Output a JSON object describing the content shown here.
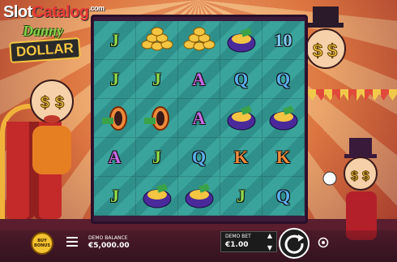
{
  "watermark": {
    "part1": "Slot",
    "part2": "Catalog",
    "dotcom": ".com"
  },
  "logo": {
    "top": "Danny",
    "bottom": "DOLLAR"
  },
  "colors": {
    "reel_bg_a": "#2f8f8a",
    "reel_bg_b": "#3aa39b",
    "frame": "#3c1a3a"
  },
  "grid": [
    [
      {
        "label": "J",
        "color": "#8fdc4a",
        "icon": "j-symbol"
      },
      {
        "label": "",
        "icon": "coin-stack-symbol"
      },
      {
        "label": "",
        "icon": "coin-stack-symbol"
      },
      {
        "label": "",
        "icon": "hat-of-gold-symbol"
      },
      {
        "label": "10",
        "color": "#7ec8f0",
        "icon": "ten-symbol"
      }
    ],
    [
      {
        "label": "J",
        "color": "#8fdc4a",
        "icon": "j-symbol"
      },
      {
        "label": "J",
        "color": "#8fdc4a",
        "icon": "j-symbol"
      },
      {
        "label": "A",
        "color": "#c86ae8",
        "icon": "a-symbol"
      },
      {
        "label": "Q",
        "color": "#5ab0f0",
        "icon": "q-symbol"
      },
      {
        "label": "Q",
        "color": "#5ab0f0",
        "icon": "q-symbol"
      }
    ],
    [
      {
        "label": "",
        "icon": "cannon-symbol"
      },
      {
        "label": "",
        "icon": "cannon-symbol"
      },
      {
        "label": "A",
        "color": "#c86ae8",
        "icon": "a-symbol"
      },
      {
        "label": "",
        "icon": "hat-of-gold-symbol"
      },
      {
        "label": "",
        "icon": "hat-of-gold-symbol"
      }
    ],
    [
      {
        "label": "A",
        "color": "#c86ae8",
        "icon": "a-symbol"
      },
      {
        "label": "J",
        "color": "#8fdc4a",
        "icon": "j-symbol"
      },
      {
        "label": "Q",
        "color": "#5ab0f0",
        "icon": "q-symbol"
      },
      {
        "label": "K",
        "color": "#f08a3a",
        "icon": "k-symbol"
      },
      {
        "label": "K",
        "color": "#f08a3a",
        "icon": "k-symbol"
      }
    ],
    [
      {
        "label": "J",
        "color": "#8fdc4a",
        "icon": "j-symbol"
      },
      {
        "label": "",
        "icon": "hat-of-gold-symbol"
      },
      {
        "label": "",
        "icon": "hat-of-gold-symbol"
      },
      {
        "label": "J",
        "color": "#8fdc4a",
        "icon": "j-symbol"
      },
      {
        "label": "Q",
        "color": "#5ab0f0",
        "icon": "q-symbol"
      }
    ]
  ],
  "controls": {
    "buy_bonus": "BUY BONUS",
    "balance_label": "DEMO BALANCE",
    "balance_value": "€5,000.00",
    "bet_label": "DEMO BET",
    "bet_value": "€1.00"
  }
}
